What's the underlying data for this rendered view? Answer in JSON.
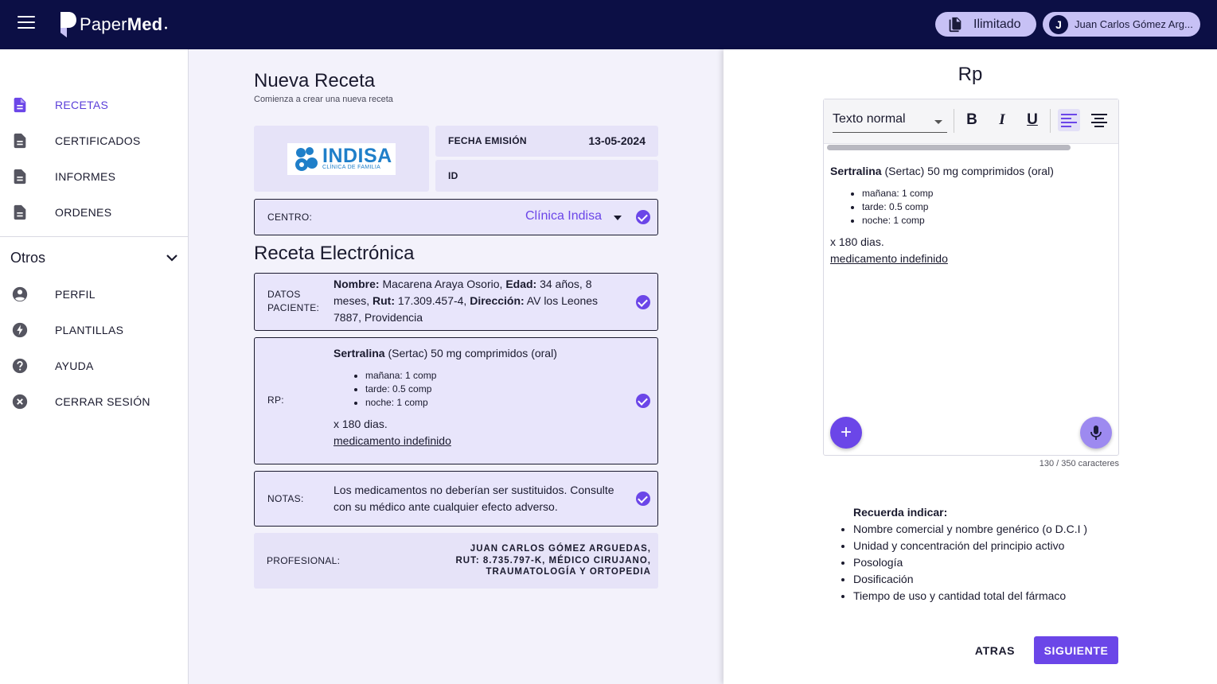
{
  "header": {
    "brand_light": "Paper",
    "brand_bold": "Med",
    "plan_label": "Ilimitado",
    "user_initial": "J",
    "user_name": "Juan Carlos Gómez Arg..."
  },
  "sidebar": {
    "items": [
      {
        "label": "RECETAS",
        "icon": "document-icon"
      },
      {
        "label": "CERTIFICADOS",
        "icon": "document-icon"
      },
      {
        "label": "INFORMES",
        "icon": "document-icon"
      },
      {
        "label": "ORDENES",
        "icon": "document-icon"
      }
    ],
    "section_label": "Otros",
    "other_items": [
      {
        "label": "PERFIL",
        "icon": "account-circle-icon"
      },
      {
        "label": "PLANTILLAS",
        "icon": "bolt-icon"
      },
      {
        "label": "AYUDA",
        "icon": "help-icon"
      },
      {
        "label": "CERRAR SESIÓN",
        "icon": "cancel-icon"
      }
    ]
  },
  "form": {
    "title": "Nueva Receta",
    "subtitle": "Comienza a crear una nueva receta",
    "clinic_logo_word": "INDISA",
    "clinic_logo_sub": "CLÍNICA DE FAMILIA",
    "fecha_label": "FECHA EMISIÓN",
    "fecha_value": "13-05-2024",
    "id_label": "ID",
    "centro_label": "CENTRO:",
    "centro_value": "Clínica Indisa",
    "section_title": "Receta Electrónica",
    "paciente": {
      "label_line1": "DATOS",
      "label_line2": "PACIENTE:",
      "nombre_k": "Nombre:",
      "nombre_v": " Macarena Araya Osorio, ",
      "edad_k": "Edad:",
      "edad_v": " 34 años, 8 meses, ",
      "rut_k": "Rut:",
      "rut_v": " 17.309.457-4, ",
      "dir_k": "Dirección:",
      "dir_v": " AV los Leones 7887, Providencia"
    },
    "rp": {
      "label": "RP:",
      "drug": "Sertralina",
      "drug_rest": " (Sertac) 50 mg comprimidos (oral)",
      "doses": [
        "mañana: 1 comp",
        "tarde: 0.5 comp",
        "noche: 1 comp"
      ],
      "duration": "x 180 dias.",
      "note": "medicamento indefinido"
    },
    "notas": {
      "label": "NOTAS:",
      "text": "Los medicamentos no deberían ser sustituidos. Consulte con su médico ante cualquier efecto adverso."
    },
    "profesional": {
      "label": "PROFESIONAL:",
      "value": "JUAN CARLOS GÓMEZ ARGUEDAS, RUT: 8.735.797-K, MÉDICO CIRUJANO, TRAUMATOLOGÍA Y ORTOPEDIA"
    }
  },
  "editor": {
    "title": "Rp",
    "format_value": "Texto normal",
    "bold_label": "B",
    "italic_label": "I",
    "underline_label": "U",
    "counter": "130 / 350 caracteres",
    "add_label": "+"
  },
  "reminder": {
    "heading": "Recuerda indicar:",
    "items": [
      "Nombre comercial y nombre genérico (o D.C.I )",
      "Unidad y concentración del principio activo",
      "Posología",
      "Dosificación",
      "Tiempo de uso y cantidad total del fármaco"
    ]
  },
  "actions": {
    "back": "ATRAS",
    "next": "SIGUIENTE"
  },
  "colors": {
    "topbar": "#0c0f45",
    "accent": "#6b46e8",
    "pill": "#c7c1f5",
    "card": "#e6e3f8"
  }
}
